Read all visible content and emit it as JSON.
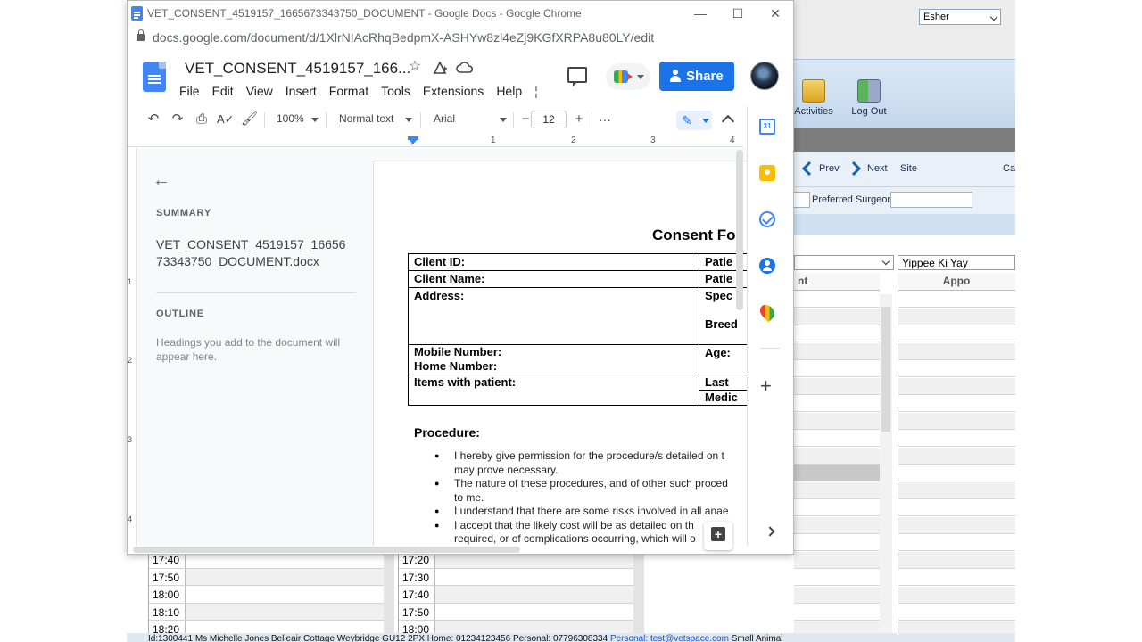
{
  "background_app": {
    "toolbar": {
      "activities_label": "Activities",
      "logout_label": "Log Out"
    },
    "nav": {
      "prev_label": "Prev",
      "next_label": "Next",
      "site_label": "Site",
      "site_value": "Esher",
      "extra_label": "Ca"
    },
    "filters": {
      "preferred_surgeon_label": "Preferred Surgeon"
    },
    "column_select_value": "Yippee Ki Yay",
    "column_headers": [
      "nt",
      "Appo"
    ],
    "calendar_left_times": [
      "17:40",
      "17:50",
      "18:00",
      "18:10",
      "18:20"
    ],
    "calendar_mid_times": [
      "17:20",
      "17:30",
      "17:40",
      "17:50",
      "18:00"
    ],
    "status_bar": {
      "text": "Id:1300441  Ms Michelle  Jones  Belleair Cottage  Weybridge  GU12 2PX  Home: 01234123456  Personal: 07796308334",
      "email": "Personal: test@vetspace.com",
      "tail": "Small Animal"
    }
  },
  "chrome": {
    "window_title": "VET_CONSENT_4519157_1665673343750_DOCUMENT - Google Docs - Google Chrome",
    "url": "docs.google.com/document/d/1XlrNIAcRhqBedpmX-ASHYw8zl4eZj9KGfXRPA8u80LY/edit",
    "controls": {
      "minimize": "—",
      "maximize": "☐",
      "close": "✕"
    }
  },
  "docs": {
    "title": "VET_CONSENT_4519157_166...",
    "menu": [
      "File",
      "Edit",
      "View",
      "Insert",
      "Format",
      "Tools",
      "Extensions",
      "Help"
    ],
    "menu_more": "¦",
    "share_label": "Share",
    "toolbar": {
      "zoom": "100%",
      "style": "Normal text",
      "font": "Arial",
      "font_size": "12",
      "minus": "−",
      "plus": "+",
      "more": "···"
    },
    "ruler_numbers": [
      "1",
      "2",
      "3",
      "4"
    ],
    "vruler_numbers": [
      "1",
      "2",
      "3",
      "4"
    ],
    "outline": {
      "summary_label": "SUMMARY",
      "summary_text": "VET_CONSENT_4519157_1665673343750_DOCUMENT.docx",
      "outline_label": "OUTLINE",
      "outline_hint": "Headings you add to the document will appear here."
    },
    "side_panel": {
      "calendar_day": "31"
    }
  },
  "document": {
    "form_title": "Consent Fo",
    "table": {
      "client_id": "Client ID:",
      "patient_1": "Patie",
      "client_name": "Client Name:",
      "patient_2": "Patie",
      "address": "Address:",
      "species": "Spec",
      "breed": "Breed",
      "mobile": "Mobile Number:",
      "home": "Home Number:",
      "age": "Age:",
      "items": "Items with patient:",
      "last": "Last",
      "medic": "Medic"
    },
    "procedure_title": "Procedure:",
    "procedure_lines": [
      {
        "text": "I hereby give permission for the procedure/s detailed on t",
        "bullet": true
      },
      {
        "text": "may prove necessary.",
        "bullet": false
      },
      {
        "text": "The nature of these procedures, and of other such proced",
        "bullet": true
      },
      {
        "text": "to me.",
        "bullet": false
      },
      {
        "text": "I understand that there are some risks involved in all anae",
        "bullet": true
      },
      {
        "text": "I accept that the likely cost will be as detailed on th",
        "bullet": true
      },
      {
        "text": "required, or of complications occurring, which will o",
        "bullet": false
      }
    ]
  }
}
